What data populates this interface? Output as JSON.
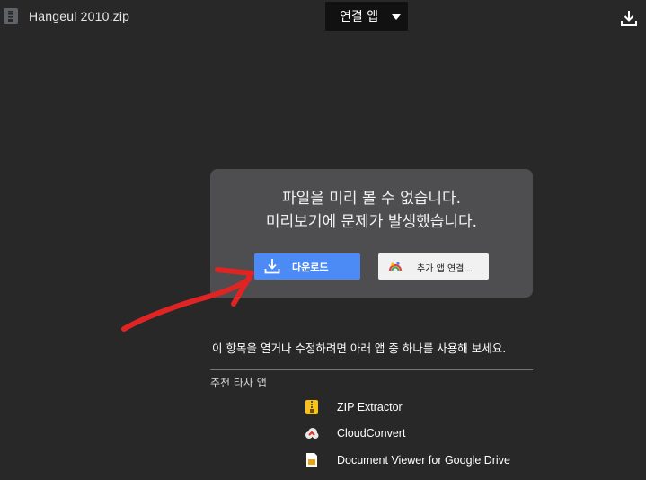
{
  "header": {
    "file_name": "Hangeul 2010.zip",
    "open_with_label": "연결 앱"
  },
  "preview_card": {
    "line1": "파일을 미리 볼 수 없습니다.",
    "line2": "미리보기에 문제가 발생했습니다.",
    "download_label": "다운로드",
    "more_apps_label": "추가 앱 연결..."
  },
  "open_hint": "이 항목을 열거나 수정하려면 아래 앱 중 하나를 사용해 보세요.",
  "recommended": {
    "title": "추천 타사 앱",
    "apps": [
      {
        "name": "ZIP Extractor",
        "icon": "zip-extractor-icon"
      },
      {
        "name": "CloudConvert",
        "icon": "cloudconvert-icon"
      },
      {
        "name": "Document Viewer for Google Drive",
        "icon": "document-viewer-icon"
      }
    ]
  },
  "colors": {
    "background": "#282828",
    "card": "#4e4d50",
    "primary_button": "#4c8bf5",
    "annotation_arrow": "#e02424"
  }
}
